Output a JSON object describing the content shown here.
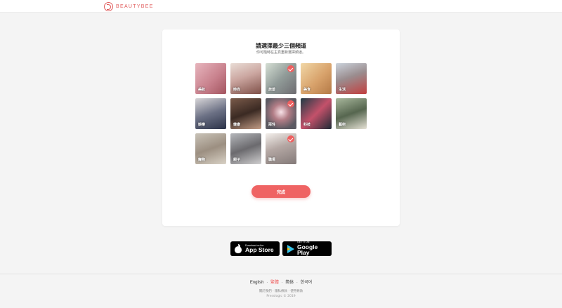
{
  "header": {
    "brand": "BEAUTYBEE"
  },
  "card": {
    "title": "請選擇最少三個頻道",
    "subtitle": "你可隨時在主頁重新選擇頻道。",
    "channels": [
      {
        "label": "美妝",
        "selected": false
      },
      {
        "label": "時尚",
        "selected": false
      },
      {
        "label": "旅遊",
        "selected": true
      },
      {
        "label": "美食",
        "selected": false
      },
      {
        "label": "生活",
        "selected": false
      },
      {
        "label": "娛樂",
        "selected": false
      },
      {
        "label": "健康",
        "selected": false
      },
      {
        "label": "兩性",
        "selected": true
      },
      {
        "label": "科技",
        "selected": false
      },
      {
        "label": "藝術",
        "selected": false
      },
      {
        "label": "寵物",
        "selected": false
      },
      {
        "label": "親子",
        "selected": false
      },
      {
        "label": "職場",
        "selected": true
      }
    ],
    "done_label": "完成"
  },
  "apps": {
    "appstore_small": "Download on the",
    "appstore_big": "App Store",
    "play_small": "GET IT ON",
    "play_big": "Google Play"
  },
  "footer": {
    "languages": [
      {
        "label": "English",
        "active": false
      },
      {
        "label": "繁體",
        "active": true
      },
      {
        "label": "简体",
        "active": false
      },
      {
        "label": "한국어",
        "active": false
      }
    ],
    "links": [
      "關於我們",
      "隱私條款",
      "使用條款"
    ],
    "copyright": "Presslogic © 2019"
  },
  "colors": {
    "accent": "#ef5f5f",
    "background": "#f4f4f4"
  }
}
